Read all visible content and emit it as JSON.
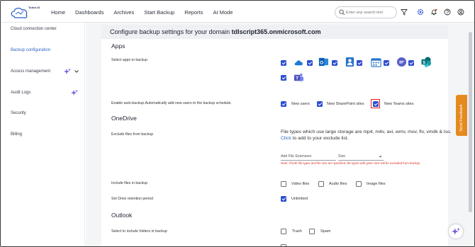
{
  "header": {
    "logo_text": "Turbo UI",
    "nav": [
      "Home",
      "Dashboards",
      "Archives",
      "Start Backup",
      "Reports",
      "AI Mode"
    ],
    "search_placeholder": "Enter any search text"
  },
  "sidebar": {
    "items": [
      {
        "label": "Cloud connection center"
      },
      {
        "label": "Backup configuration",
        "active": true
      },
      {
        "label": "Access management"
      },
      {
        "label": "Audit Logs"
      },
      {
        "label": "Security"
      },
      {
        "label": "Billing"
      }
    ]
  },
  "panel": {
    "title_prefix": "Configure backup settings for your domain",
    "title_domain": "tdlscript365.onmicrosoft.com",
    "apps": {
      "section": "Apps",
      "select_label": "Select apps to backup",
      "icons": [
        "onedrive-icon",
        "outlook-icon",
        "contacts-icon",
        "calendar-icon",
        "teams-chat-icon",
        "sharepoint-icon",
        "teams-icon"
      ],
      "auto_label": "Enable auto-backup.Automatically add new users to the backup schedule.",
      "auto_options": [
        "New users",
        "New SharePoint sites",
        "New Teams sites"
      ]
    },
    "onedrive": {
      "section": "OneDrive",
      "exclude_label": "Exclude files from backup",
      "exclude_info": "File types which use large storage are mp4, m4v, avi, wmv, mov, flv, vmdk & iso.",
      "click_text": "Click",
      "click_rest": " to add to your exclude list.",
      "ext_placeholder": "Add File Extension",
      "size_placeholder": "Size",
      "note": "Note: If both file types and file size are specified, file types with given size will be excluded from backup.",
      "include_label": "Include files in backup",
      "include_options": [
        "Video files",
        "Audio files",
        "Image files"
      ],
      "retention_label": "Set Drive retention period",
      "retention_value": "Unlimited"
    },
    "outlook": {
      "section": "Outlook",
      "folders_label": "Select to include folders in backup",
      "folder_options": [
        "Trash",
        "Spam"
      ]
    }
  },
  "feedback_label": "Send Feedback",
  "colors": {
    "accent": "#2d4fd0",
    "highlight": "#e02020",
    "feedback": "#e58a1f"
  }
}
